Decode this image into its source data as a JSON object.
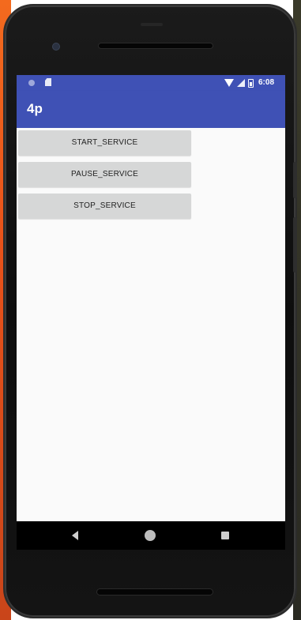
{
  "status_bar": {
    "time": "6:08"
  },
  "app_bar": {
    "title": "4p"
  },
  "buttons": {
    "start": "START_SERVICE",
    "pause": "PAUSE_SERVICE",
    "stop": "STOP_SERVICE"
  },
  "colors": {
    "primary": "#3f51b5",
    "button_bg": "#d6d7d7",
    "screen_bg": "#fafafa"
  },
  "icons": {
    "status_left": [
      "circle-notification-icon",
      "sd-card-icon"
    ],
    "status_right": [
      "wifi-icon",
      "signal-icon",
      "battery-icon"
    ],
    "nav": [
      "back-icon",
      "home-icon",
      "recents-icon"
    ]
  }
}
